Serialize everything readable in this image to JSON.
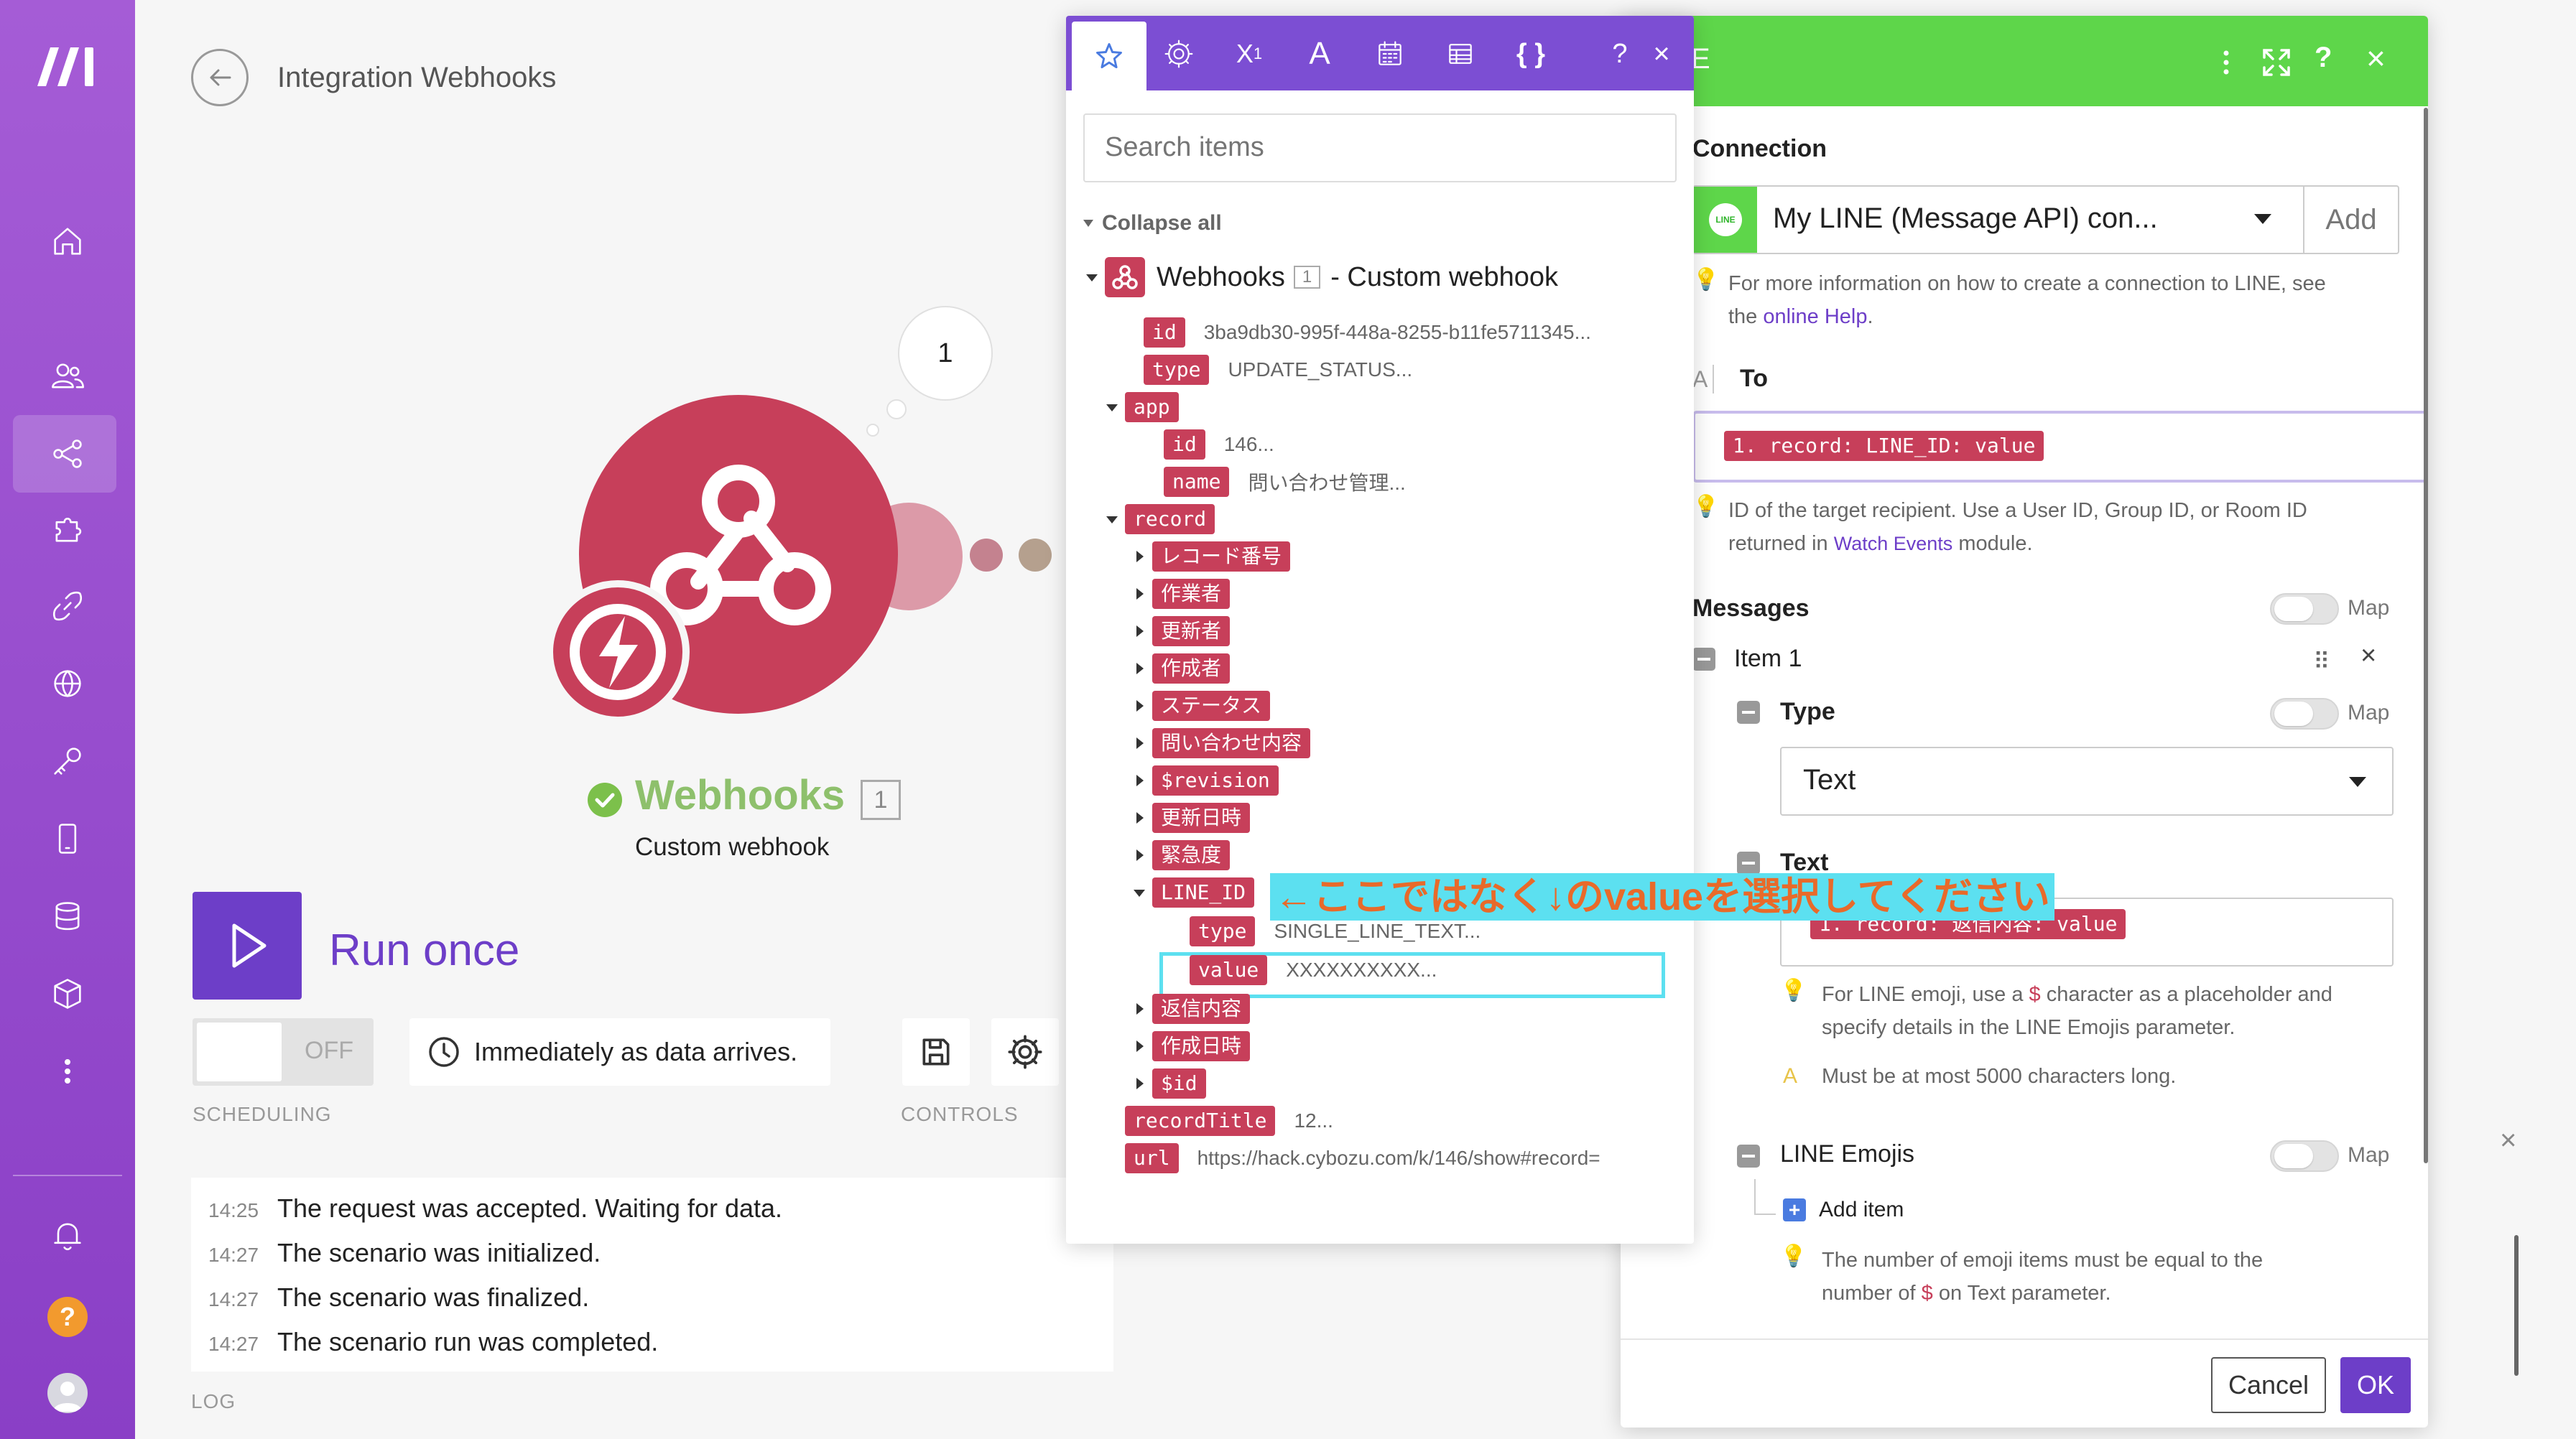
{
  "sidebar": {
    "logo": "m",
    "icons": [
      "home-icon",
      "team-icon",
      "scenarios-icon",
      "templates-icon",
      "connections-icon",
      "webhooks-icon",
      "keys-icon",
      "devices-icon",
      "datastores-icon",
      "datastructures-icon",
      "more-icon",
      "notifications-icon",
      "help-icon",
      "profile-icon"
    ],
    "help_glyph": "?"
  },
  "header": {
    "title": "Integration Webhooks"
  },
  "canvas": {
    "module_name": "Webhooks",
    "module_count": "1",
    "module_subtitle": "Custom webhook",
    "bubble_count": "1"
  },
  "controls": {
    "run_once": "Run once",
    "toggle_state": "OFF",
    "schedule_text": "Immediately as data arrives.",
    "scheduling_label": "SCHEDULING",
    "controls_label": "CONTROLS",
    "log_label": "LOG"
  },
  "log": [
    {
      "time": "14:25",
      "msg": "The request was accepted. Waiting for data."
    },
    {
      "time": "14:27",
      "msg": "The scenario was initialized."
    },
    {
      "time": "14:27",
      "msg": "The scenario was finalized."
    },
    {
      "time": "14:27",
      "msg": "The scenario run was completed."
    }
  ],
  "picker": {
    "tabs": [
      "star-icon",
      "gear-icon",
      "superscript-icon",
      "text-icon",
      "calendar-icon",
      "table-icon",
      "braces-icon"
    ],
    "help": "?",
    "close": "×",
    "search_placeholder": "Search items",
    "collapse_all": "Collapse all",
    "root_name": "Webhooks",
    "root_count": "1",
    "root_suffix": "- Custom webhook",
    "items": [
      {
        "key": "id",
        "value": "3ba9db30-995f-448a-8255-b11fe5711345..."
      },
      {
        "key": "type",
        "value": "UPDATE_STATUS..."
      },
      {
        "key": "app",
        "value": ""
      },
      {
        "key": "id",
        "value": "146..."
      },
      {
        "key": "name",
        "value": "問い合わせ管理..."
      },
      {
        "key": "record",
        "value": ""
      },
      {
        "key": "レコード番号",
        "value": ""
      },
      {
        "key": "作業者",
        "value": ""
      },
      {
        "key": "更新者",
        "value": ""
      },
      {
        "key": "作成者",
        "value": ""
      },
      {
        "key": "ステータス",
        "value": ""
      },
      {
        "key": "問い合わせ内容",
        "value": ""
      },
      {
        "key": "$revision",
        "value": ""
      },
      {
        "key": "更新日時",
        "value": ""
      },
      {
        "key": "緊急度",
        "value": ""
      },
      {
        "key": "LINE_ID",
        "value": ""
      },
      {
        "key": "type",
        "value": "SINGLE_LINE_TEXT..."
      },
      {
        "key": "value",
        "value": "XXXXXXXXXX..."
      },
      {
        "key": "返信内容",
        "value": ""
      },
      {
        "key": "作成日時",
        "value": ""
      },
      {
        "key": "$id",
        "value": ""
      },
      {
        "key": "recordTitle",
        "value": "12..."
      },
      {
        "key": "url",
        "value": "https://hack.cybozu.com/k/146/show#record="
      }
    ],
    "annotation": "←ここではなく↓のvalueを選択してください"
  },
  "settings": {
    "header_letter": "E",
    "connection_label": "Connection",
    "connection_value": "My LINE (Message API) con...",
    "add_label": "Add",
    "connection_hint_1": "For more information on how to create a connection to LINE, see",
    "connection_hint_2": "the",
    "connection_hint_link": "online Help",
    "connection_hint_end": ".",
    "to_prefix": "A",
    "to_label": "To",
    "to_token": "1. record: LINE_ID: value",
    "to_hint_1": "ID of the target recipient. Use a User ID, Group ID, or Room ID",
    "to_hint_2": "returned in",
    "to_hint_link": "Watch Events",
    "to_hint_end": "module.",
    "messages_label": "Messages",
    "map": "Map",
    "item_label": "Item 1",
    "type_label": "Type",
    "type_value": "Text",
    "text_label": "Text",
    "text_token": "1. record: 返信内容: value",
    "text_hint_1a": "For LINE emoji, use a",
    "text_hint_dollar": "$",
    "text_hint_1b": "character as a placeholder and",
    "text_hint_2": "specify details in the LINE Emojis parameter.",
    "text_limit_prefix": "A",
    "text_limit": "Must be at most 5000 characters long.",
    "emojis_label": "LINE Emojis",
    "add_item": "Add item",
    "emoji_hint_1": "The number of emoji items must be equal to the",
    "emoji_hint_2a": "number of",
    "emoji_hint_dollar": "$",
    "emoji_hint_2b": "on Text parameter.",
    "cancel": "Cancel",
    "ok": "OK"
  },
  "colors": {
    "sidebar": "#9b4fd2",
    "accent": "#6d3ec8",
    "webhook": "#c73f5a",
    "line_green": "#5ed64a",
    "highlight": "#5ce0f0"
  }
}
